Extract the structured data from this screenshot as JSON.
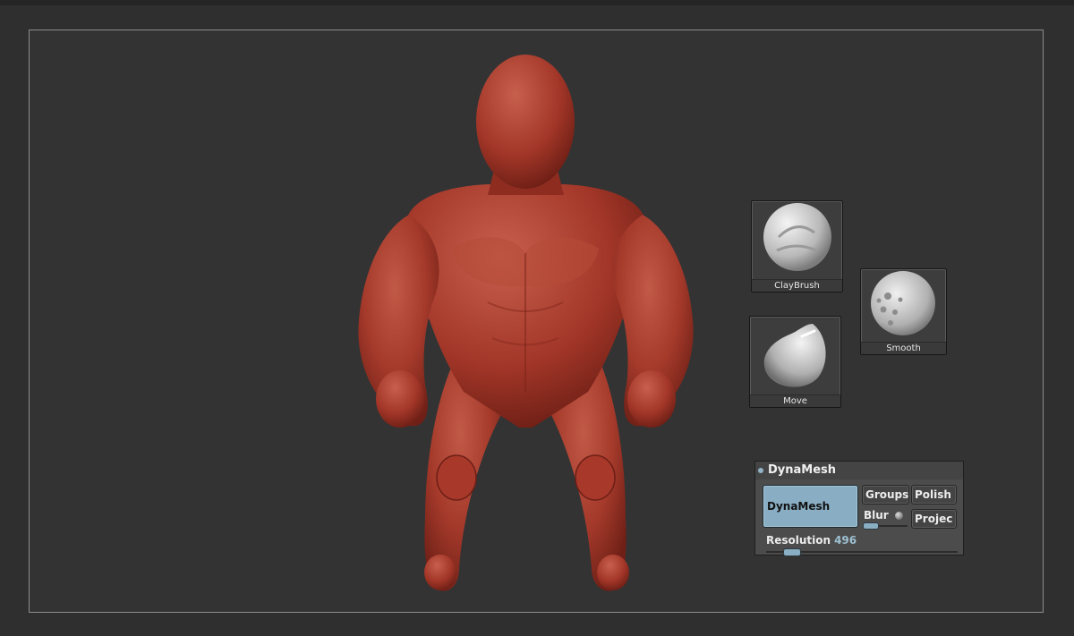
{
  "brushes": [
    {
      "id": "claybrush",
      "label": "ClayBrush",
      "icon": "claybrush-sphere-icon"
    },
    {
      "id": "smooth",
      "label": "Smooth",
      "icon": "smooth-sphere-icon"
    },
    {
      "id": "move",
      "label": "Move",
      "icon": "move-sphere-icon"
    }
  ],
  "dynamesh": {
    "title": "DynaMesh",
    "main_button": "DynaMesh",
    "groups": "Groups",
    "polish": "Polish",
    "blur": "Blur",
    "project": "Projec",
    "resolution_label": "Resolution",
    "resolution_value": "496",
    "accent": "#89aec4"
  },
  "colors": {
    "viewport_bg": "#333333",
    "model": "#a8392a"
  }
}
